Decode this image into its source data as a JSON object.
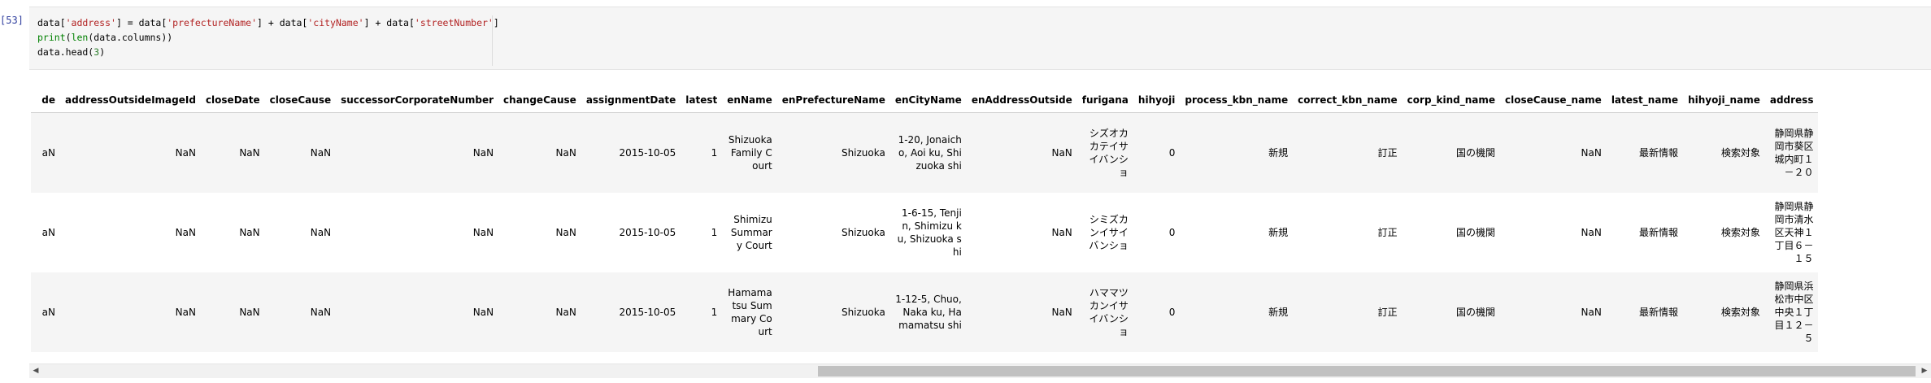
{
  "cell": {
    "prompt": "[53]",
    "code_lines": [
      [
        {
          "t": "data[",
          "c": "kw"
        },
        {
          "t": "'address'",
          "c": "str"
        },
        {
          "t": "] = data[",
          "c": "kw"
        },
        {
          "t": "'prefectureName'",
          "c": "str"
        },
        {
          "t": "] + data[",
          "c": "kw"
        },
        {
          "t": "'cityName'",
          "c": "str"
        },
        {
          "t": "] + data[",
          "c": "kw"
        },
        {
          "t": "'streetNumber'",
          "c": "str"
        },
        {
          "t": "]",
          "c": "kw"
        }
      ],
      [
        {
          "t": "print",
          "c": "fn"
        },
        {
          "t": "(",
          "c": "kw"
        },
        {
          "t": "len",
          "c": "fn"
        },
        {
          "t": "(data.columns))",
          "c": "kw"
        }
      ],
      [
        {
          "t": "data.head(",
          "c": "kw"
        },
        {
          "t": "3",
          "c": "num"
        },
        {
          "t": ")",
          "c": "kw"
        }
      ]
    ]
  },
  "table": {
    "columns": [
      "de",
      "addressOutsideImageId",
      "closeDate",
      "closeCause",
      "successorCorporateNumber",
      "changeCause",
      "assignmentDate",
      "latest",
      "enName",
      "enPrefectureName",
      "enCityName",
      "enAddressOutside",
      "furigana",
      "hihyoji",
      "process_kbn_name",
      "correct_kbn_name",
      "corp_kind_name",
      "closeCause_name",
      "latest_name",
      "hihyoji_name",
      "address"
    ],
    "rows": [
      [
        "aN",
        "NaN",
        "NaN",
        "NaN",
        "NaN",
        "NaN",
        "2015-10-05",
        "1",
        "Shizuoka Family Court",
        "Shizuoka",
        "1-20, Jonaicho, Aoi ku, Shizuoka shi",
        "NaN",
        "シズオカカテイサイバンショ",
        "0",
        "新規",
        "訂正",
        "国の機関",
        "NaN",
        "最新情報",
        "検索対象",
        "静岡県静岡市葵区城内町１－２０"
      ],
      [
        "aN",
        "NaN",
        "NaN",
        "NaN",
        "NaN",
        "NaN",
        "2015-10-05",
        "1",
        "Shimizu Summary Court",
        "Shizuoka",
        "1-6-15, Tenjin, Shimizu ku, Shizuoka shi",
        "NaN",
        "シミズカンイサイバンショ",
        "0",
        "新規",
        "訂正",
        "国の機関",
        "NaN",
        "最新情報",
        "検索対象",
        "静岡県静岡市清水区天神１丁目６－１５"
      ],
      [
        "aN",
        "NaN",
        "NaN",
        "NaN",
        "NaN",
        "NaN",
        "2015-10-05",
        "1",
        "Hamamatsu Summary Court",
        "Shizuoka",
        "1-12-5, Chuo, Naka ku, Hamamatsu shi",
        "NaN",
        "ハママツカンイサイバンショ",
        "0",
        "新規",
        "訂正",
        "国の機関",
        "NaN",
        "最新情報",
        "検索対象",
        "静岡県浜松市中区中央１丁目１２－５"
      ]
    ]
  },
  "scrollbar": {
    "left_arrow": "◀",
    "right_arrow": "▶"
  }
}
